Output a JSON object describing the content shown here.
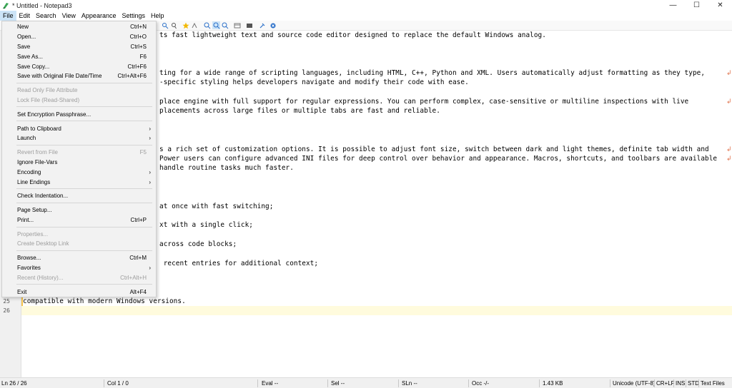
{
  "window": {
    "title": "* Untitled - Notepad3",
    "minimize": "—",
    "maximize": "☐",
    "close": "✕"
  },
  "menubar": [
    "File",
    "Edit",
    "Search",
    "View",
    "Appearance",
    "Settings",
    "Help"
  ],
  "file_menu": [
    {
      "label": "New",
      "shortcut": "Ctrl+N"
    },
    {
      "label": "Open...",
      "shortcut": "Ctrl+O"
    },
    {
      "label": "Save",
      "shortcut": "Ctrl+S"
    },
    {
      "label": "Save As...",
      "shortcut": "F6"
    },
    {
      "label": "Save Copy...",
      "shortcut": "Ctrl+F6"
    },
    {
      "label": "Save with Original File Date/Time",
      "shortcut": "Ctrl+Alt+F6"
    },
    {
      "label": "Read Only File Attribute",
      "shortcut": ""
    },
    {
      "label": "Lock File (Read-Shared)",
      "shortcut": ""
    },
    {
      "label": "Set Encryption Passphrase...",
      "shortcut": ""
    },
    {
      "label": "Path to Clipboard",
      "shortcut": ""
    },
    {
      "label": "Launch",
      "shortcut": ""
    },
    {
      "label": "Revert from File",
      "shortcut": "F5"
    },
    {
      "label": "Ignore File-Vars",
      "shortcut": ""
    },
    {
      "label": "Encoding",
      "shortcut": ""
    },
    {
      "label": "Line Endings",
      "shortcut": ""
    },
    {
      "label": "Check Indentation...",
      "shortcut": ""
    },
    {
      "label": "Page Setup...",
      "shortcut": ""
    },
    {
      "label": "Print...",
      "shortcut": "Ctrl+P"
    },
    {
      "label": "Properties...",
      "shortcut": ""
    },
    {
      "label": "Create Desktop Link",
      "shortcut": ""
    },
    {
      "label": "Browse...",
      "shortcut": "Ctrl+M"
    },
    {
      "label": "Favorites",
      "shortcut": ""
    },
    {
      "label": "Recent (History)...",
      "shortcut": "Ctrl+Alt+H"
    },
    {
      "label": "Exit",
      "shortcut": "Alt+F4"
    }
  ],
  "editor": {
    "lines": [
      "ts fast lightweight text and source code editor designed to replace the default Windows analog.",
      "ting for a wide range of scripting languages, including HTML, C++, Python and XML. Users automatically adjust formatting as they type,",
      "-specific styling helps developers navigate and modify their code with ease.",
      "place engine with full support for regular expressions. You can perform complex, case-sensitive or multiline inspections with live",
      "placements across large files or multiple tabs are fast and reliable.",
      "s a rich set of customization options. It is possible to adjust font size, switch between dark and light themes, definite tab width and",
      "Power users can configure advanced INI files for deep control over behavior and appearance. Macros, shortcuts, and toolbars are available",
      "handle routine tasks much faster.",
      "at once with fast switching;",
      "xt with a single click;",
      "across code blocks;",
      " recent entries for additional context;",
      "compatible with modern Windows versions."
    ],
    "line_numbers": [
      "25",
      "26"
    ],
    "wrap_symbol": "↲"
  },
  "statusbar": {
    "ln": "Ln  26 / 26",
    "col": "Col  1 / 0",
    "eval": "Eval  --",
    "sel": "Sel  --",
    "sln": "SLn  --",
    "occ": "Occ  -/-",
    "size": "1.43 KB",
    "encoding": "Unicode (UTF-8)",
    "eol": "CR+LF",
    "ins": "INS",
    "std": "STD",
    "type": "Text Files"
  }
}
